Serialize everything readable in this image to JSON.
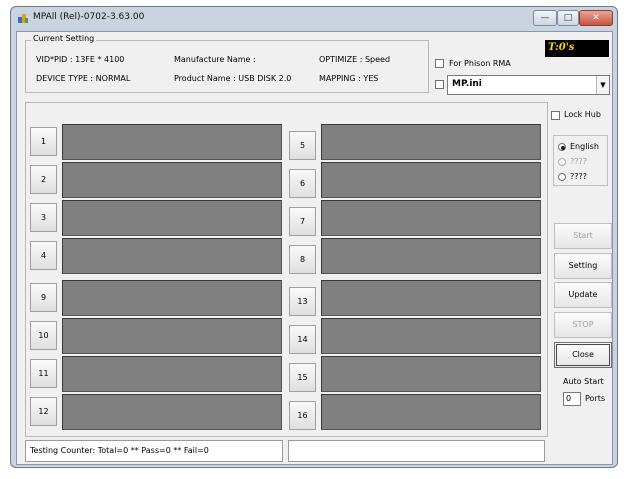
{
  "window": {
    "title": "MPAll (Rel)-0702-3.63.00",
    "minimize_glyph": "—",
    "maximize_glyph": "□",
    "close_glyph": "✕"
  },
  "current_setting": {
    "legend": "Current Setting",
    "vid_pid": "VID*PID : 13FE * 4100",
    "manufacture_name": "Manufacture Name :",
    "optimize": "OPTIMIZE : Speed",
    "device_type": "DEVICE TYPE : NORMAL",
    "product_name": "Product Name : USB DISK 2.0",
    "mapping": "MAPPING : YES"
  },
  "for_phison_rma_label": "For Phison RMA",
  "timer": "T:0's",
  "ini_select": {
    "value": "MP.ini",
    "arrow": "▼"
  },
  "lock_hub_label": "Lock Hub",
  "languages": [
    {
      "label": "English",
      "selected": true
    },
    {
      "label": "????",
      "selected": false,
      "disabled": true
    },
    {
      "label": "????",
      "selected": false
    }
  ],
  "ports_left": [
    "1",
    "2",
    "3",
    "4",
    "9",
    "10",
    "11",
    "12"
  ],
  "ports_right": [
    "5",
    "6",
    "7",
    "8",
    "13",
    "14",
    "15",
    "16"
  ],
  "buttons": {
    "start": "Start",
    "setting": "Setting",
    "update": "Update",
    "stop": "STOP",
    "close": "Close"
  },
  "auto_start": {
    "label": "Auto Start",
    "value": "0",
    "ports_label": "Ports"
  },
  "status": {
    "counter": "Testing Counter: Total=0 ** Pass=0 ** Fail=0",
    "message": ""
  },
  "colors": {
    "port_box": "#808080",
    "timer_bg": "#000000",
    "timer_text": "#ffd800"
  }
}
